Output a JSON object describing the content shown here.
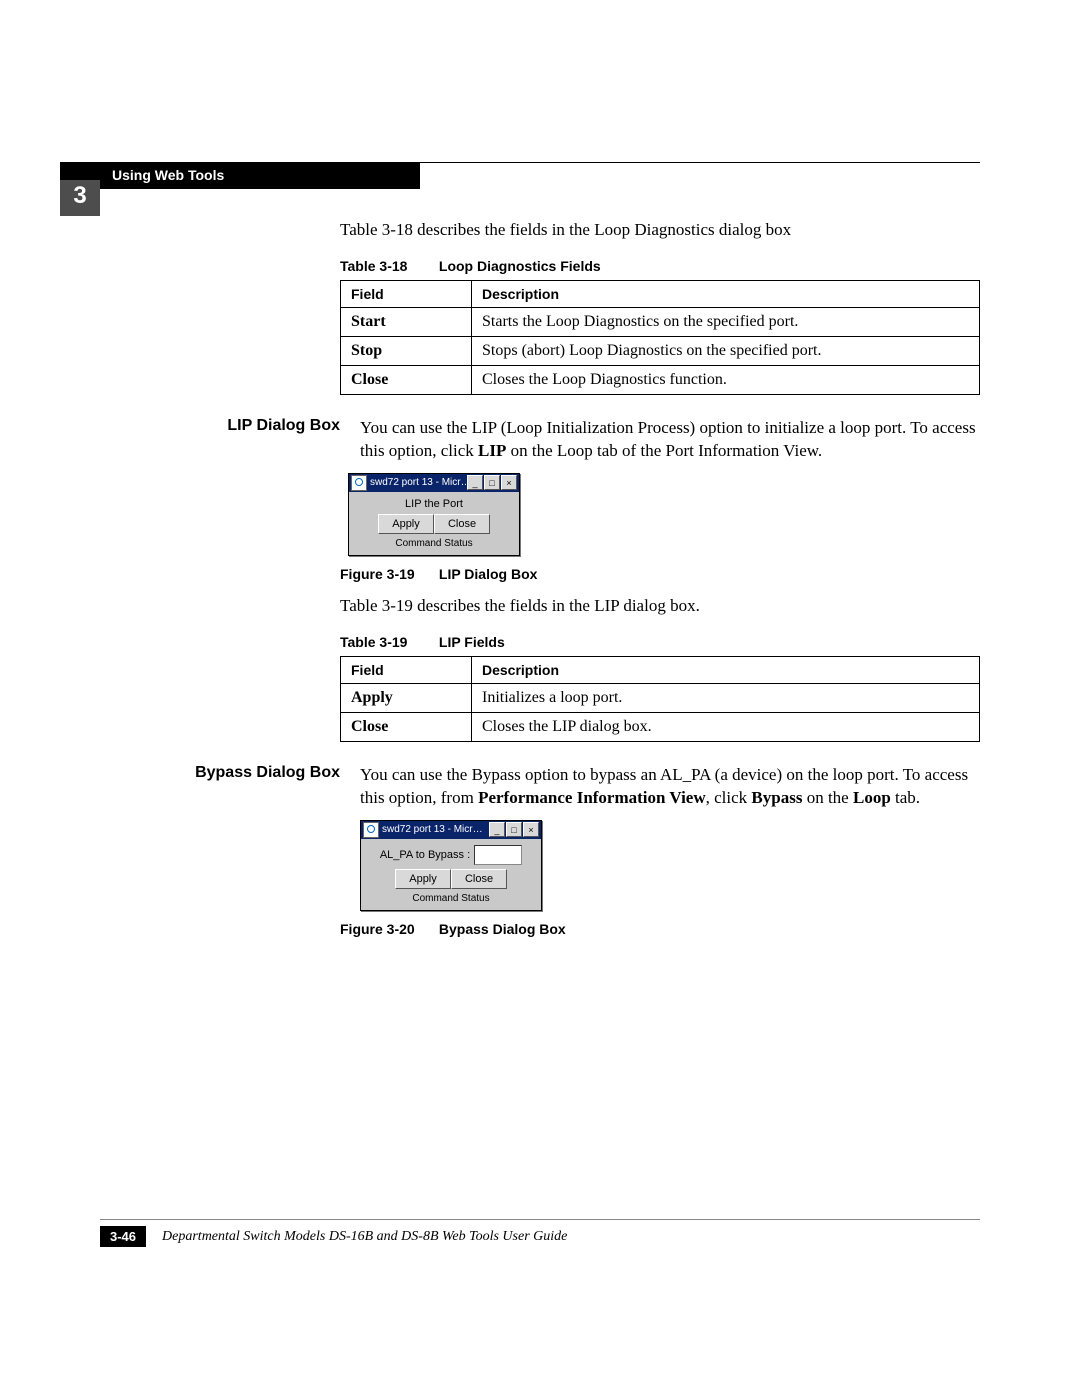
{
  "header": {
    "chapter_number": "3",
    "chapter_title": "Using Web Tools"
  },
  "intro_text": "Table 3-18 describes the fields in the Loop Diagnostics dialog box",
  "table318": {
    "caption_num": "Table 3-18",
    "caption_title": "Loop Diagnostics Fields",
    "head_field": "Field",
    "head_desc": "Description",
    "rows": [
      {
        "field": "Start",
        "desc": "Starts the Loop Diagnostics on the specified port."
      },
      {
        "field": "Stop",
        "desc": "Stops (abort) Loop Diagnostics on the specified port."
      },
      {
        "field": "Close",
        "desc": "Closes the Loop Diagnostics function."
      }
    ]
  },
  "lip_section": {
    "label": "LIP Dialog Box",
    "body_pre": "You can use the LIP (Loop Initialization Process) option to initialize a loop port. To access this option, click ",
    "body_bold": "LIP",
    "body_post": " on the Loop tab of the Port Information View."
  },
  "lip_dialog": {
    "title": "swd72 port 13 - Micr…",
    "line1": "LIP the Port",
    "btn_apply": "Apply",
    "btn_close": "Close",
    "status": "Command Status"
  },
  "fig319": {
    "num": "Figure 3-19",
    "title": "LIP Dialog Box"
  },
  "mid_text": "Table 3-19 describes the fields in the LIP dialog box.",
  "table319": {
    "caption_num": "Table 3-19",
    "caption_title": "LIP Fields",
    "head_field": "Field",
    "head_desc": "Description",
    "rows": [
      {
        "field": "Apply",
        "desc": "Initializes a loop port."
      },
      {
        "field": "Close",
        "desc": "Closes the LIP dialog box."
      }
    ]
  },
  "bypass_section": {
    "label": "Bypass Dialog Box",
    "body_pre": "You can use the Bypass option to bypass an AL_PA (a device) on the loop port. To access this option, from ",
    "body_bold1": "Performance Information View",
    "body_mid": ", click ",
    "body_bold2": "Bypass",
    "body_mid2": " on the ",
    "body_bold3": "Loop",
    "body_post": " tab."
  },
  "bypass_dialog": {
    "title": "swd72 port 13 - Micr…",
    "field_label": "AL_PA to Bypass :",
    "btn_apply": "Apply",
    "btn_close": "Close",
    "status": "Command Status"
  },
  "fig320": {
    "num": "Figure 3-20",
    "title": "Bypass Dialog Box"
  },
  "footer": {
    "page": "3-46",
    "text": "Departmental Switch Models DS-16B and DS-8B Web Tools User Guide"
  }
}
